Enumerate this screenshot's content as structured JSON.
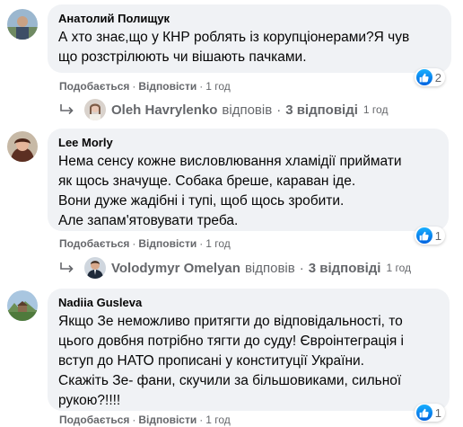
{
  "comments": [
    {
      "author": "Анатолий Полищук",
      "lines": [
        "А хто знає,що у КНР роблять із корупціонерами?Я чув",
        "що розстрілюють чи вішають пачками."
      ],
      "like_label": "Подобається",
      "reply_label": "Відповісти",
      "time": "1 год",
      "reaction_count": "2",
      "reply_thread": {
        "name": "Oleh Havrylenko",
        "verb": "відповів",
        "count_text": "3 відповіді",
        "time": "1 год"
      }
    },
    {
      "author": "Lee Morly",
      "lines": [
        "Нема сенсу кожне висловлювання хламідії приймати",
        "як щось значуще. Собака бреше, караван іде.",
        "Вони дуже жадібні і тупі, щоб щось зробити.",
        "Але запам'ятовувати треба."
      ],
      "like_label": "Подобається",
      "reply_label": "Відповісти",
      "time": "1 год",
      "reaction_count": "1",
      "reply_thread": {
        "name": "Volodymyr Omelyan",
        "verb": "відповів",
        "count_text": "3 відповіді",
        "time": "1 год"
      }
    },
    {
      "author": "Nadiia Gusleva",
      "lines": [
        "Якщо Зе неможливо притягти до відповідальності, то",
        "цього довбня потрібно тягти до суду! Євроінтеграція і",
        "вступ до НАТО прописані у конституції України.",
        "Скажіть Зе- фани, скучили за більшовиками, сильної",
        "рукою?!!!!"
      ],
      "like_label": "Подобається",
      "reply_label": "Відповісти",
      "time": "1 год",
      "reaction_count": "1"
    }
  ],
  "separator": "·",
  "icons": {
    "like": "thumbs-up-icon",
    "reply_arrow": "reply-arrow-icon"
  },
  "colors": {
    "bubble": "#f0f2f5",
    "meta_text": "#65676b",
    "like_blue": "#1877f2"
  }
}
